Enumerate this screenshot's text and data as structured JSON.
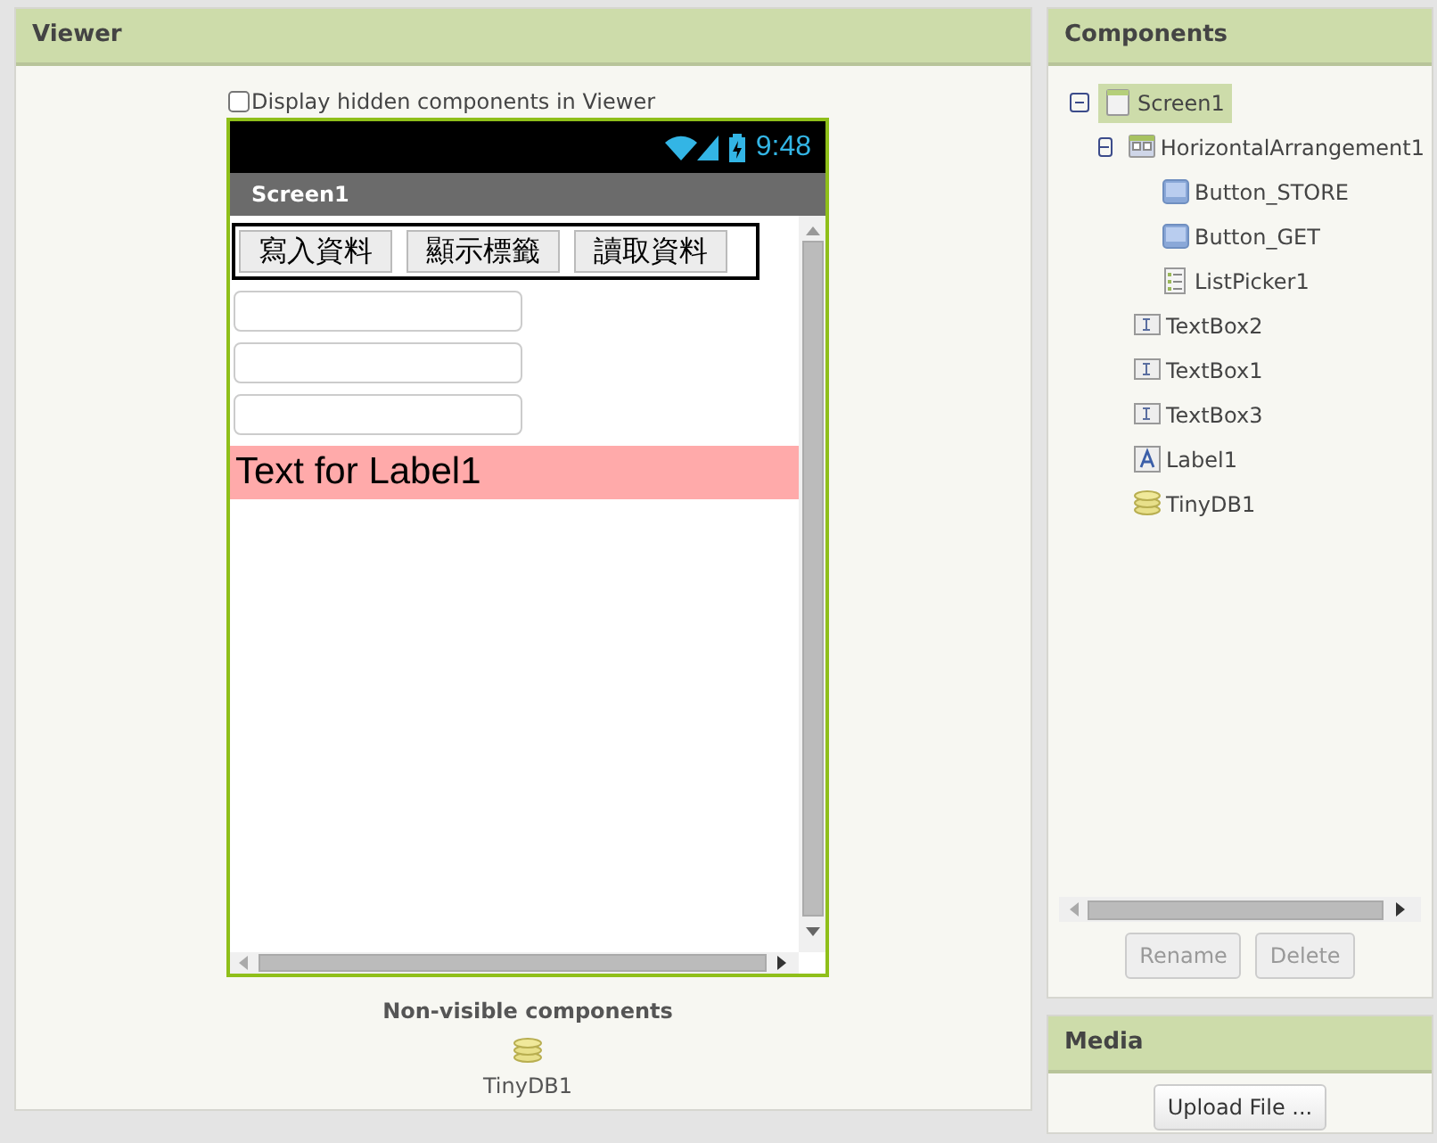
{
  "viewer": {
    "title": "Viewer",
    "hidden_toggle": {
      "label": "Display hidden components in Viewer",
      "checked": false
    },
    "phone": {
      "time": "9:48",
      "screen_title": "Screen1",
      "selected": true,
      "items": [
        {
          "kind": "arrangement",
          "buttons": [
            "寫入資料",
            "顯示標籤",
            "讀取資料"
          ]
        },
        {
          "kind": "textbox"
        },
        {
          "kind": "textbox"
        },
        {
          "kind": "textbox"
        },
        {
          "kind": "label",
          "text": "Text for Label1",
          "color": "#ffaaaa"
        }
      ]
    },
    "non_visible": {
      "title": "Non-visible components",
      "items": [
        {
          "label": "TinyDB1"
        }
      ]
    }
  },
  "components": {
    "title": "Components",
    "tree": [
      {
        "label": "Screen1",
        "kind": "screen",
        "selected": true,
        "expanded": true,
        "children": [
          {
            "label": "HorizontalArrangement1",
            "kind": "arrangement",
            "selected": false,
            "expanded": true,
            "children": [
              {
                "label": "Button_STORE",
                "kind": "button",
                "selected": false
              },
              {
                "label": "Button_GET",
                "kind": "button",
                "selected": false
              },
              {
                "label": "ListPicker1",
                "kind": "listpicker",
                "selected": false
              }
            ]
          },
          {
            "label": "TextBox2",
            "kind": "textbox",
            "selected": false
          },
          {
            "label": "TextBox1",
            "kind": "textbox",
            "selected": false
          },
          {
            "label": "TextBox3",
            "kind": "textbox",
            "selected": false
          },
          {
            "label": "Label1",
            "kind": "label",
            "selected": false
          },
          {
            "label": "TinyDB1",
            "kind": "tinydb",
            "selected": false
          }
        ]
      }
    ],
    "buttons": [
      {
        "label": "Rename",
        "disabled": true
      },
      {
        "label": "Delete",
        "disabled": true
      }
    ]
  },
  "media": {
    "title": "Media",
    "buttons": [
      {
        "label": "Upload File ...",
        "disabled": false
      }
    ]
  }
}
